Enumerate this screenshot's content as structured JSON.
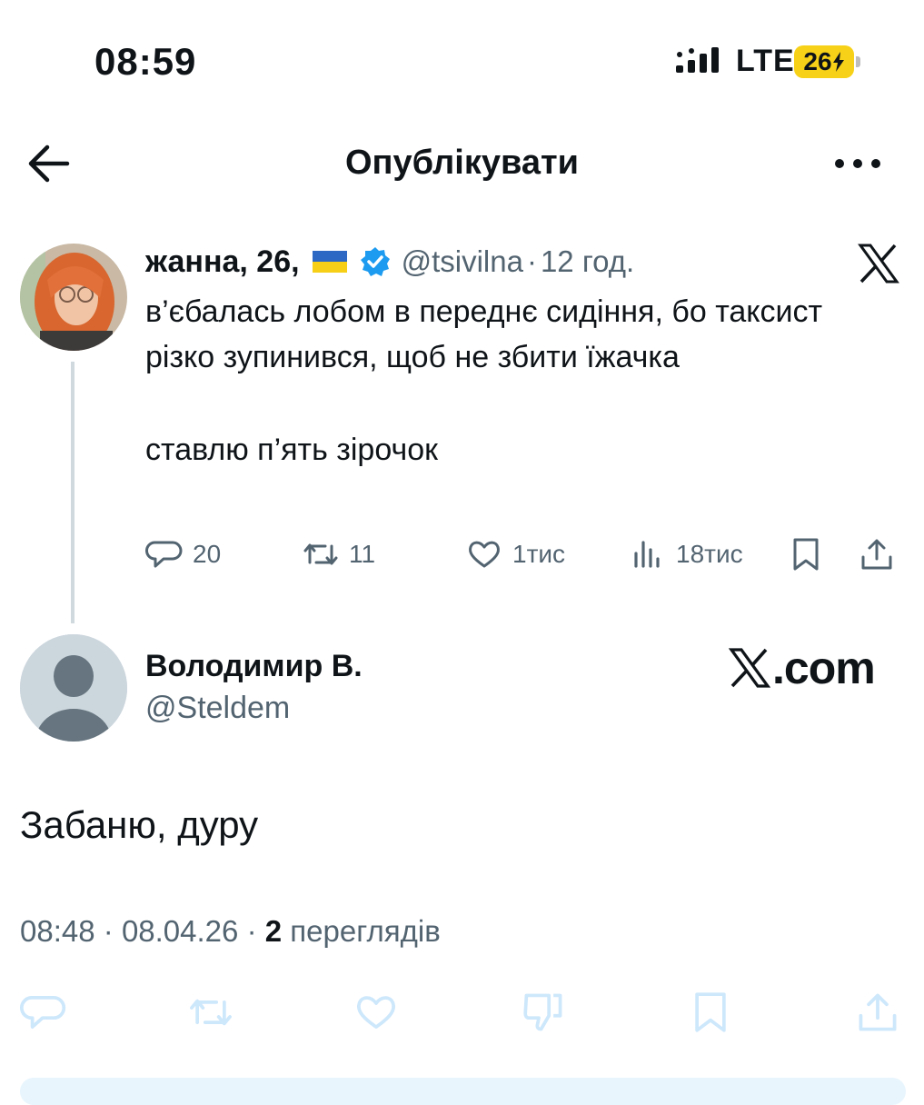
{
  "status_bar": {
    "time": "08:59",
    "network": "LTE",
    "battery": "26",
    "battery_icon": "charging-bolt-icon",
    "battery_color": "#f7d117"
  },
  "header": {
    "title": "Опублікувати"
  },
  "quoted_tweet": {
    "display_name": "жанна, 26,",
    "flag": "ukraine-flag-icon",
    "verified": true,
    "handle": "@tsivilna",
    "separator": "·",
    "time": "12 год.",
    "text_paragraph_1": "в’єбалась лобом в переднє сидіння, бо таксист різко зупинився, щоб не збити їжачка",
    "text_paragraph_2": "ставлю п’ять зірочок",
    "stats": {
      "replies": "20",
      "retweets": "11",
      "likes": "1тис",
      "views": "18тис"
    }
  },
  "reply_tweet": {
    "display_name": "Володимир В.",
    "handle": "@Steldem",
    "brand": ".com",
    "text": "Забаню, дуру",
    "time": "08:48",
    "sep1": "·",
    "date": "08.04.26",
    "sep2": "·",
    "views_count": "2",
    "views_label": "переглядів"
  },
  "colors": {
    "text_primary": "#0f1419",
    "text_secondary": "#536471",
    "verified_blue": "#1d9bf0",
    "actions_faded": "#cde7fb",
    "thread_line": "#cfd9de"
  }
}
